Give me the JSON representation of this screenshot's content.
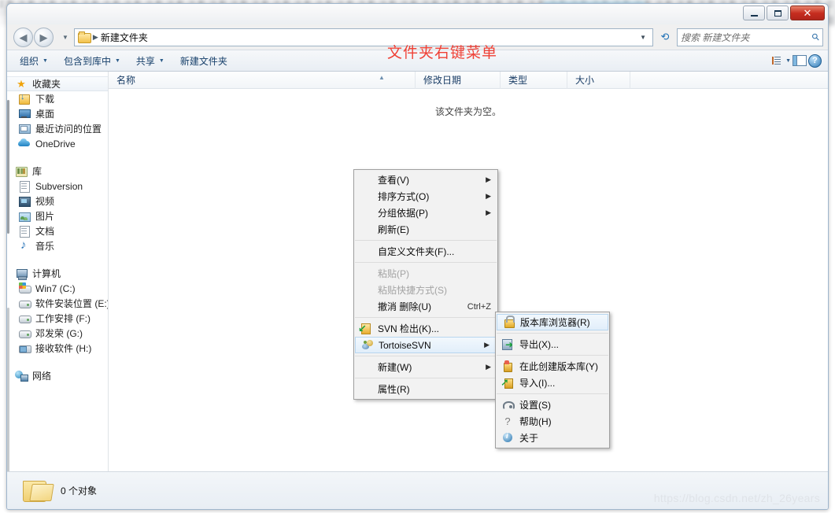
{
  "window": {
    "address_path": "新建文件夹",
    "minimize_label": "最小化",
    "maximize_label": "最大化",
    "close_label": "✕"
  },
  "search": {
    "placeholder": "搜索 新建文件夹"
  },
  "command_bar": {
    "items": [
      {
        "label": "组织",
        "caret": "▼"
      },
      {
        "label": "包含到库中",
        "caret": "▼"
      },
      {
        "label": "共享",
        "caret": "▼"
      },
      {
        "label": "新建文件夹",
        "caret": ""
      }
    ]
  },
  "sidebar": {
    "groups": [
      {
        "head": {
          "label": "收藏夹",
          "icon": "star-icon",
          "selected": true
        },
        "items": [
          {
            "label": "下载",
            "icon": "downloads-icon"
          },
          {
            "label": "桌面",
            "icon": "desktop-icon"
          },
          {
            "label": "最近访问的位置",
            "icon": "recent-places-icon"
          },
          {
            "label": "OneDrive",
            "icon": "onedrive-icon"
          }
        ]
      },
      {
        "head": {
          "label": "库",
          "icon": "library-icon",
          "selected": false
        },
        "items": [
          {
            "label": "Subversion",
            "icon": "document-icon"
          },
          {
            "label": "视频",
            "icon": "video-icon"
          },
          {
            "label": "图片",
            "icon": "picture-icon"
          },
          {
            "label": "文档",
            "icon": "document-icon"
          },
          {
            "label": "音乐",
            "icon": "music-icon"
          }
        ]
      },
      {
        "head": {
          "label": "计算机",
          "icon": "computer-icon",
          "selected": false
        },
        "items": [
          {
            "label": "Win7 (C:)",
            "icon": "windows-drive-icon"
          },
          {
            "label": "软件安装位置 (E:)",
            "icon": "drive-icon"
          },
          {
            "label": "工作安排 (F:)",
            "icon": "drive-icon"
          },
          {
            "label": "邓发荣 (G:)",
            "icon": "drive-icon"
          },
          {
            "label": "接收软件 (H:)",
            "icon": "network-drive-icon"
          }
        ]
      },
      {
        "head": {
          "label": "网络",
          "icon": "network-icon",
          "selected": false
        },
        "items": []
      }
    ]
  },
  "file_list": {
    "columns": [
      {
        "label": "名称"
      },
      {
        "label": "修改日期"
      },
      {
        "label": "类型"
      },
      {
        "label": "大小"
      }
    ],
    "empty_message": "该文件夹为空。"
  },
  "annotation": {
    "text": "文件夹右键菜单",
    "color": "#ef4136"
  },
  "context_menu": {
    "items": [
      {
        "label": "查看(V)",
        "arrow": "▶",
        "disabled": false,
        "accel": "",
        "icon": ""
      },
      {
        "label": "排序方式(O)",
        "arrow": "▶",
        "disabled": false,
        "accel": "",
        "icon": ""
      },
      {
        "label": "分组依据(P)",
        "arrow": "▶",
        "disabled": false,
        "accel": "",
        "icon": ""
      },
      {
        "label": "刷新(E)",
        "arrow": "",
        "disabled": false,
        "accel": "",
        "icon": ""
      },
      {
        "separator": true
      },
      {
        "label": "自定义文件夹(F)...",
        "arrow": "",
        "disabled": false,
        "accel": "",
        "icon": ""
      },
      {
        "separator": true
      },
      {
        "label": "粘贴(P)",
        "arrow": "",
        "disabled": true,
        "accel": "",
        "icon": ""
      },
      {
        "label": "粘贴快捷方式(S)",
        "arrow": "",
        "disabled": true,
        "accel": "",
        "icon": ""
      },
      {
        "label": "撤消 删除(U)",
        "arrow": "",
        "disabled": false,
        "accel": "Ctrl+Z",
        "icon": ""
      },
      {
        "separator": true
      },
      {
        "label": "SVN 检出(K)...",
        "arrow": "",
        "disabled": false,
        "accel": "",
        "icon": "svn-checkout-icon"
      },
      {
        "label": "TortoiseSVN",
        "arrow": "▶",
        "disabled": false,
        "accel": "",
        "icon": "tortoisesvn-icon",
        "highlight": true
      },
      {
        "separator": true
      },
      {
        "label": "新建(W)",
        "arrow": "▶",
        "disabled": false,
        "accel": "",
        "icon": ""
      },
      {
        "separator": true
      },
      {
        "label": "属性(R)",
        "arrow": "",
        "disabled": false,
        "accel": "",
        "icon": ""
      }
    ]
  },
  "submenu": {
    "items": [
      {
        "label": "版本库浏览器(R)",
        "icon": "repo-browser-icon",
        "highlight": true
      },
      {
        "separator": true
      },
      {
        "label": "导出(X)...",
        "icon": "export-icon"
      },
      {
        "separator": true
      },
      {
        "label": "在此创建版本库(Y)",
        "icon": "create-repo-icon"
      },
      {
        "label": "导入(I)...",
        "icon": "import-icon"
      },
      {
        "separator": true
      },
      {
        "label": "设置(S)",
        "icon": "settings-icon"
      },
      {
        "label": "帮助(H)",
        "icon": "help-icon"
      },
      {
        "label": "关于",
        "icon": "about-icon"
      }
    ]
  },
  "status_bar": {
    "text": "0 个对象"
  },
  "watermark": {
    "text": "https://blog.csdn.net/zh_26years"
  }
}
